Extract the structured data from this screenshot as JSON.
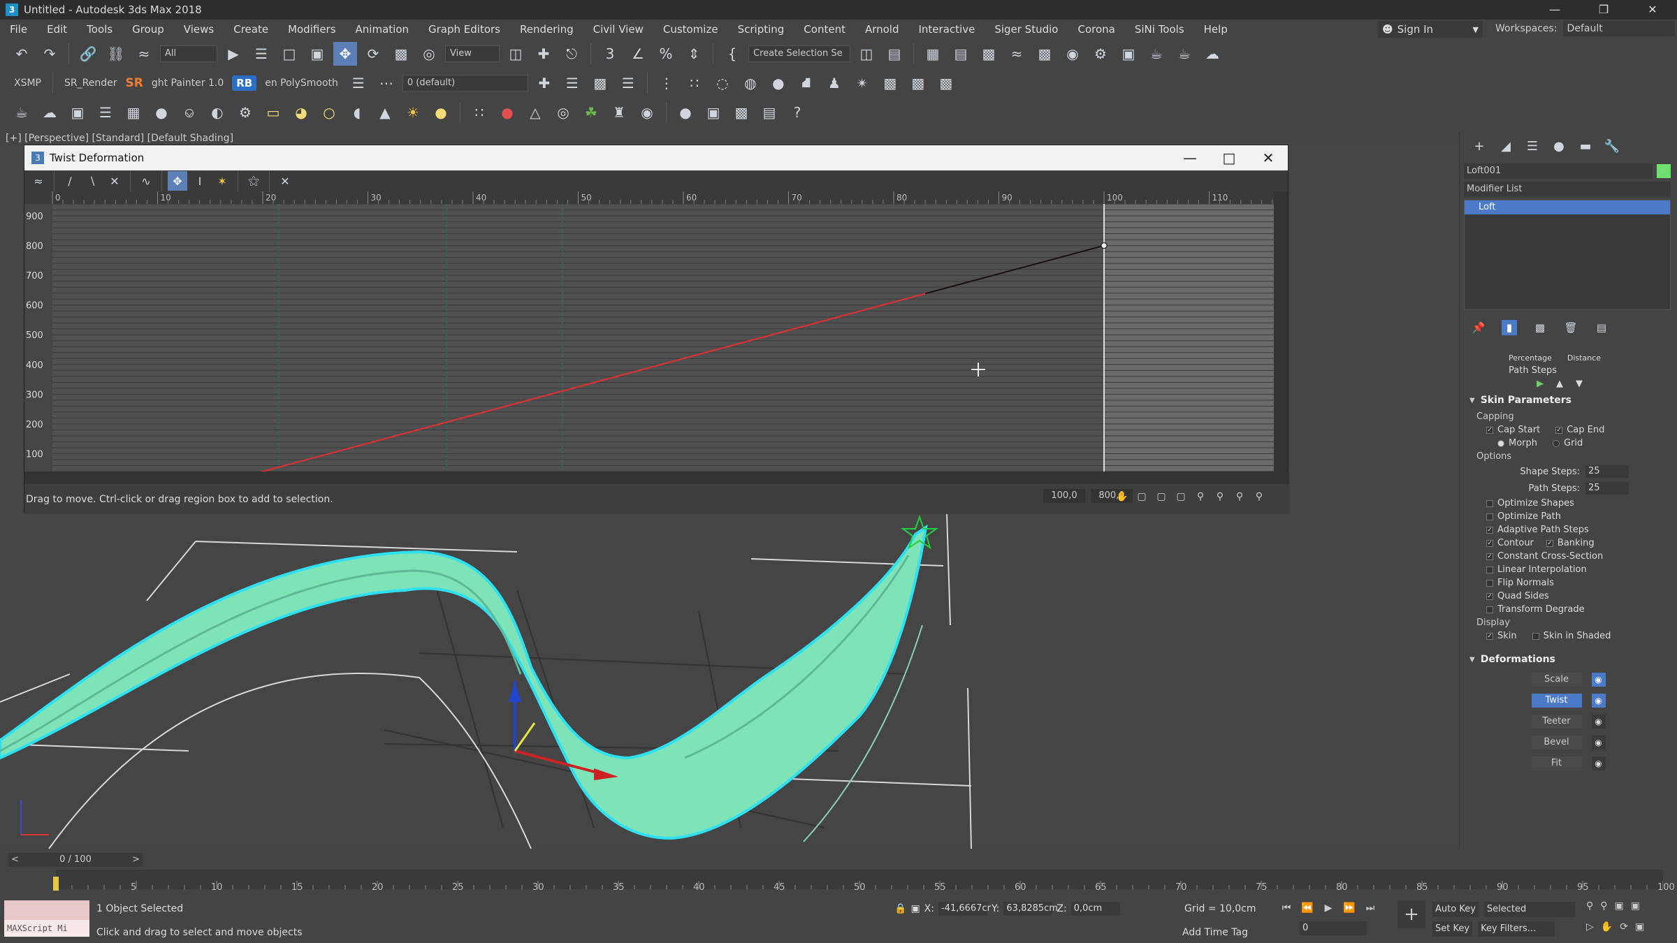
{
  "window": {
    "title": "Untitled - Autodesk 3ds Max 2018"
  },
  "menu": [
    "File",
    "Edit",
    "Tools",
    "Group",
    "Views",
    "Create",
    "Modifiers",
    "Animation",
    "Graph Editors",
    "Rendering",
    "Civil View",
    "Customize",
    "Scripting",
    "Content",
    "Arnold",
    "Interactive",
    "Siger Studio",
    "Corona",
    "SiNi Tools",
    "Help"
  ],
  "account": {
    "signin": "Sign In",
    "workspaces_label": "Workspaces:",
    "workspace": "Default"
  },
  "toolbar1": {
    "filter": "All",
    "view": "View",
    "create_selection": "Create Selection Se"
  },
  "toolbar2": {
    "xsmp": "XSMP",
    "sr_render": "SR_Render",
    "sr": "SR",
    "painter": "ght Painter 1.0",
    "rb": "RB",
    "polysmooth": "en PolySmooth",
    "layer": "0 (default)"
  },
  "viewport": {
    "label": "[+] [Perspective] [Standard] [Default Shading]"
  },
  "twist_dialog": {
    "title": "Twist Deformation",
    "status": "Drag to move. Ctrl-click or drag region box to add to selection.",
    "value1": "100,0",
    "value2": "800,0",
    "ruler": [
      "0",
      "10",
      "20",
      "30",
      "40",
      "50",
      "60",
      "70",
      "80",
      "90",
      "100",
      "110"
    ],
    "yaxis": [
      "900",
      "800",
      "700",
      "600",
      "500",
      "400",
      "300",
      "200",
      "100"
    ]
  },
  "chart_data": {
    "type": "line",
    "title": "Twist Deformation",
    "xlim": [
      0,
      115
    ],
    "ylim": [
      40,
      940
    ],
    "x": [
      0,
      100
    ],
    "series": [
      {
        "values": [
          -150,
          800
        ]
      }
    ],
    "grid": true
  },
  "command_panel": {
    "object_name": "Loft001",
    "modifier_list": "Modifier List",
    "stack_item": "Loft",
    "path_steps": "Path Steps",
    "percentage": "Percentage",
    "distance": "Distance",
    "skin_parameters": "Skin Parameters",
    "capping": "Capping",
    "cap_start": "Cap Start",
    "cap_end": "Cap End",
    "morph": "Morph",
    "grid": "Grid",
    "options": "Options",
    "shape_steps_label": "Shape Steps:",
    "shape_steps": "25",
    "path_steps_label": "Path Steps:",
    "path_steps_val": "25",
    "checks": [
      {
        "label": "Optimize Shapes",
        "checked": false
      },
      {
        "label": "Optimize Path",
        "checked": false
      },
      {
        "label": "Adaptive Path Steps",
        "checked": true
      },
      {
        "label": "Contour",
        "checked": true
      },
      {
        "label": "Constant Cross-Section",
        "checked": true
      },
      {
        "label": "Linear Interpolation",
        "checked": false
      },
      {
        "label": "Flip Normals",
        "checked": false
      },
      {
        "label": "Quad Sides",
        "checked": true
      },
      {
        "label": "Transform Degrade",
        "checked": false
      }
    ],
    "banking": "Banking",
    "display": "Display",
    "skin": "Skin",
    "skin_in_shaded": "Skin in Shaded",
    "deformations": "Deformations",
    "def_buttons": [
      "Scale",
      "Twist",
      "Teeter",
      "Bevel",
      "Fit"
    ]
  },
  "timeline": {
    "frame": "0 / 100",
    "ticks": [
      "5",
      "10",
      "15",
      "20",
      "25",
      "30",
      "35",
      "40",
      "45",
      "50",
      "55",
      "60",
      "65",
      "70",
      "75",
      "80",
      "85",
      "90",
      "95",
      "100"
    ]
  },
  "status": {
    "maxscript": "MAXScript Mi",
    "selected": "1 Object Selected",
    "prompt": "Click and drag to select and move objects",
    "x_label": "X:",
    "x": "-41,6667cr",
    "y_label": "Y:",
    "y": "63,8285cm",
    "z_label": "Z:",
    "z": "0,0cm",
    "grid": "Grid = 10,0cm",
    "add_time_tag": "Add Time Tag",
    "auto_key": "Auto Key",
    "set_key": "Set Key",
    "selected_mode": "Selected",
    "key_filters": "Key Filters...",
    "frame_value": "0"
  }
}
